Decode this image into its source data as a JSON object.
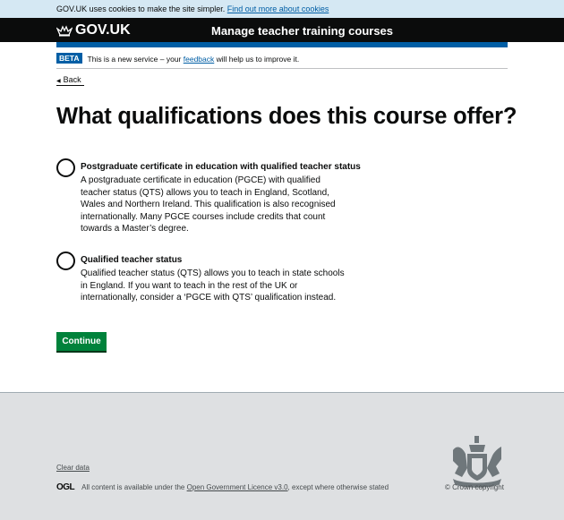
{
  "cookie_banner": {
    "text": "GOV.UK uses cookies to make the site simpler.",
    "link": "Find out more about cookies"
  },
  "header": {
    "logo": "GOV.UK",
    "service_name": "Manage teacher training courses"
  },
  "phase_banner": {
    "tag": "BETA",
    "text_before": "This is a new service – your",
    "link": "feedback",
    "text_after": "will help us to improve it."
  },
  "back_link": "Back",
  "page_title": "What qualifications does this course offer?",
  "options": [
    {
      "label": "Postgraduate certificate in education with qualified teacher status",
      "hint": "A postgraduate certificate in education (PGCE) with qualified teacher status (QTS) allows you to teach in England, Scotland, Wales and Northern Ireland. This qualification is also recognised internationally. Many PGCE courses include credits that count towards a Master’s degree.",
      "selected": false
    },
    {
      "label": "Qualified teacher status",
      "hint": "Qualified teacher status (QTS) allows you to teach in state schools in England. If you want to teach in the rest of the UK or internationally, consider a ‘PGCE with QTS’ qualification instead.",
      "selected": false
    }
  ],
  "continue_label": "Continue",
  "footer": {
    "clear_data": "Clear data",
    "ogl_logo": "OGL",
    "licence_before": "All content is available under the",
    "licence_link": "Open Government Licence v3.0",
    "licence_after": ", except where otherwise stated",
    "copyright": "© Crown copyright"
  }
}
